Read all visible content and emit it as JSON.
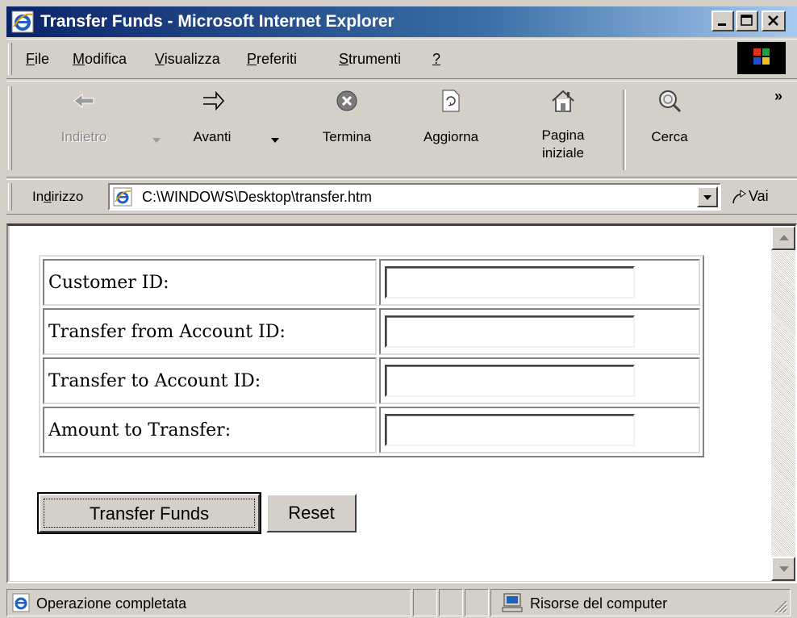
{
  "window": {
    "title": "Transfer Funds - Microsoft Internet Explorer"
  },
  "menu": {
    "items": [
      {
        "label": "File",
        "accel": "F",
        "rest": "ile"
      },
      {
        "label": "Modifica",
        "accel": "M",
        "rest": "odifica"
      },
      {
        "label": "Visualizza",
        "accel": "V",
        "rest": "isualizza"
      },
      {
        "label": "Preferiti",
        "accel": "P",
        "rest": "referiti"
      },
      {
        "label": "Strumenti",
        "accel": "S",
        "rest": "trumenti"
      },
      {
        "label": "?",
        "accel": "?",
        "rest": ""
      }
    ]
  },
  "toolbar": {
    "back": "Indietro",
    "forward": "Avanti",
    "stop": "Termina",
    "refresh": "Aggiorna",
    "home_line1": "Pagina",
    "home_line2": "iniziale",
    "search": "Cerca",
    "more": "»"
  },
  "address": {
    "label_pre": "In",
    "label_accel": "d",
    "label_post": "irizzo",
    "url": "C:\\WINDOWS\\Desktop\\transfer.htm",
    "go": "Vai"
  },
  "form": {
    "rows": [
      {
        "label": "Customer ID:",
        "value": ""
      },
      {
        "label": "Transfer from Account ID:",
        "value": ""
      },
      {
        "label": "Transfer to Account ID:",
        "value": ""
      },
      {
        "label": "Amount to Transfer:",
        "value": ""
      }
    ],
    "submit": "Transfer Funds",
    "reset": "Reset"
  },
  "status": {
    "text": "Operazione completata",
    "zone": "Risorse del computer"
  },
  "colors": {
    "titlebar_start": "#0a246a",
    "titlebar_end": "#a6caf0",
    "chrome": "#d4d0c8"
  }
}
